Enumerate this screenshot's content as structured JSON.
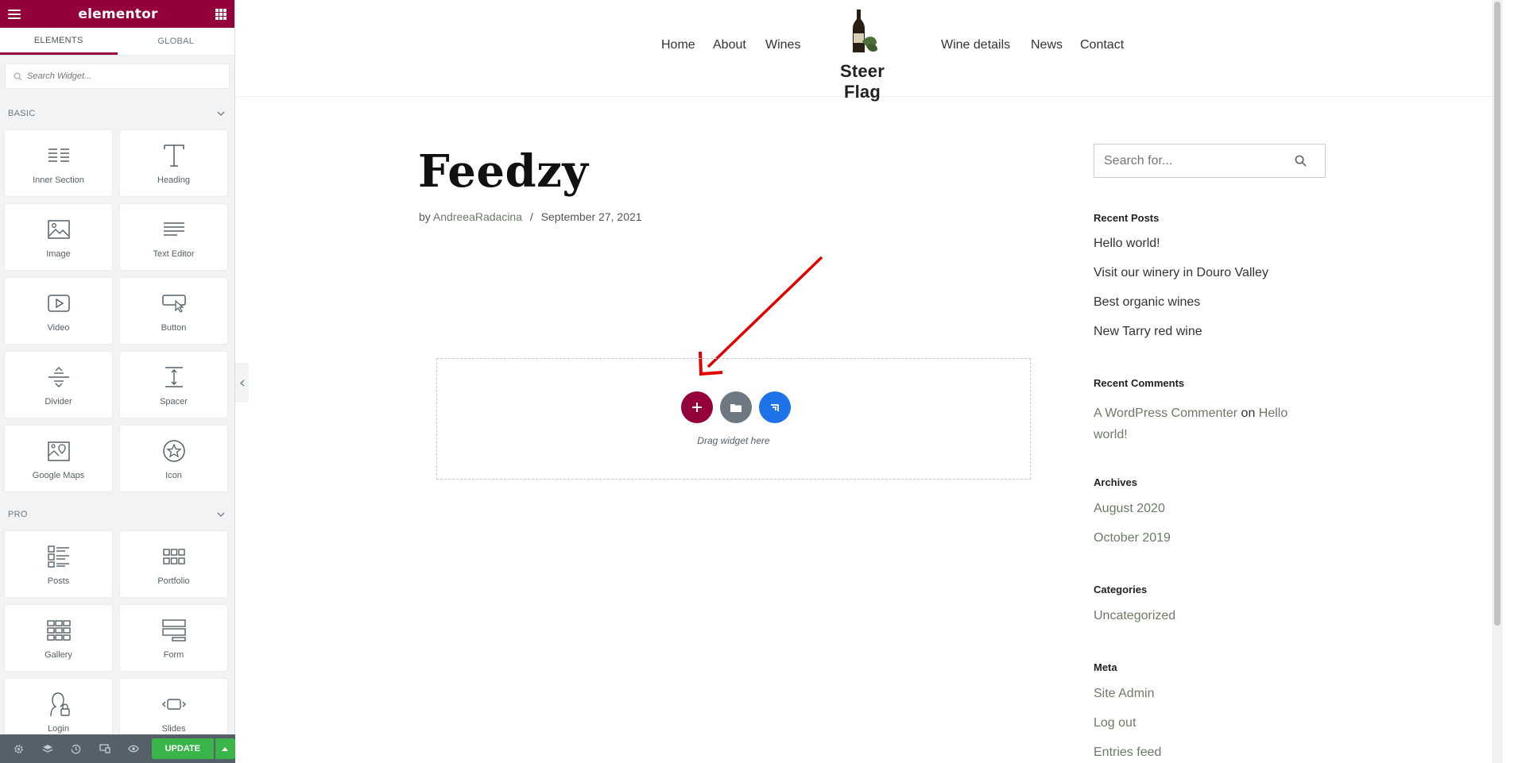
{
  "panel": {
    "brand": "elementor",
    "tabs": [
      "ELEMENTS",
      "GLOBAL"
    ],
    "search_placeholder": "Search Widget...",
    "categories": [
      {
        "name": "BASIC",
        "widgets": [
          "Inner Section",
          "Heading",
          "Image",
          "Text Editor",
          "Video",
          "Button",
          "Divider",
          "Spacer",
          "Google Maps",
          "Icon"
        ]
      },
      {
        "name": "PRO",
        "widgets": [
          "Posts",
          "Portfolio",
          "Gallery",
          "Form",
          "Login",
          "Slides"
        ]
      }
    ],
    "footer": {
      "update_label": "UPDATE"
    }
  },
  "site": {
    "nav_left": [
      "Home",
      "About",
      "Wines"
    ],
    "nav_right": [
      "Wine details",
      "News",
      "Contact"
    ],
    "logo_text": "Steer Flag",
    "post": {
      "title": "Feedzy",
      "by": "by",
      "author": "AndreeaRadacina",
      "separator": "/",
      "date": "September 27, 2021"
    },
    "drop_zone": {
      "text": "Drag widget here"
    },
    "sidebar": {
      "search_placeholder": "Search for...",
      "recent_posts_title": "Recent Posts",
      "recent_posts": [
        "Hello world!",
        "Visit our winery in Douro Valley",
        "Best organic wines",
        "New Tarry red wine"
      ],
      "recent_comments_title": "Recent Comments",
      "comment_author": "A WordPress Commenter",
      "comment_on": "on",
      "comment_post_line1": "Hello",
      "comment_post_line2": "world!",
      "archives_title": "Archives",
      "archives": [
        "August 2020",
        "October 2019"
      ],
      "categories_title": "Categories",
      "categories": [
        "Uncategorized"
      ],
      "meta_title": "Meta",
      "meta": [
        "Site Admin",
        "Log out",
        "Entries feed"
      ]
    }
  },
  "colors": {
    "brand": "#93003c",
    "update_green": "#39b54a",
    "link_green": "#6c7a68",
    "annotation_red": "#e00000"
  }
}
